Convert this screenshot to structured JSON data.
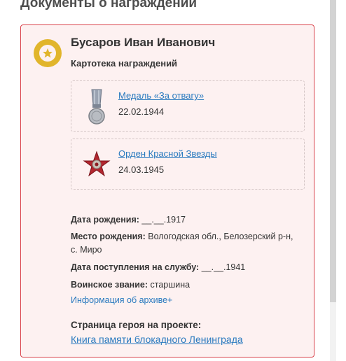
{
  "section": {
    "title": "Документы о награждении"
  },
  "hero": {
    "name": "Бусаров Иван Иванович",
    "subtitle": "Картотека награждений",
    "badge_icon": "star-medal-icon"
  },
  "awards": [
    {
      "name": "Медаль «За отвагу»",
      "date": "22.02.1944",
      "icon": "medal-for-courage-icon"
    },
    {
      "name": "Орден Красной Звезды",
      "date": "24.03.1945",
      "icon": "order-red-star-icon"
    }
  ],
  "details": {
    "birth_label": "Дата рождения:",
    "birth_value": " __.__.1917",
    "place_label": "Место рождения:",
    "place_value": " Вологодская обл., Белозерский р-н, с. Миро",
    "service_label": "Дата поступления на службу:",
    "service_value": " __.__.1941",
    "rank_label": "Воинское звание:",
    "rank_value": " старшина"
  },
  "archive_link": "Информация об архиве+",
  "project": {
    "label": "Страница героя на проекте:",
    "link": "Книга памяти блокадного Ленинграда"
  },
  "colors": {
    "accent_link": "#2a7abf",
    "card_border": "#d9444d",
    "card_bg": "#fdf1f1",
    "badge": "#e1b52b"
  }
}
